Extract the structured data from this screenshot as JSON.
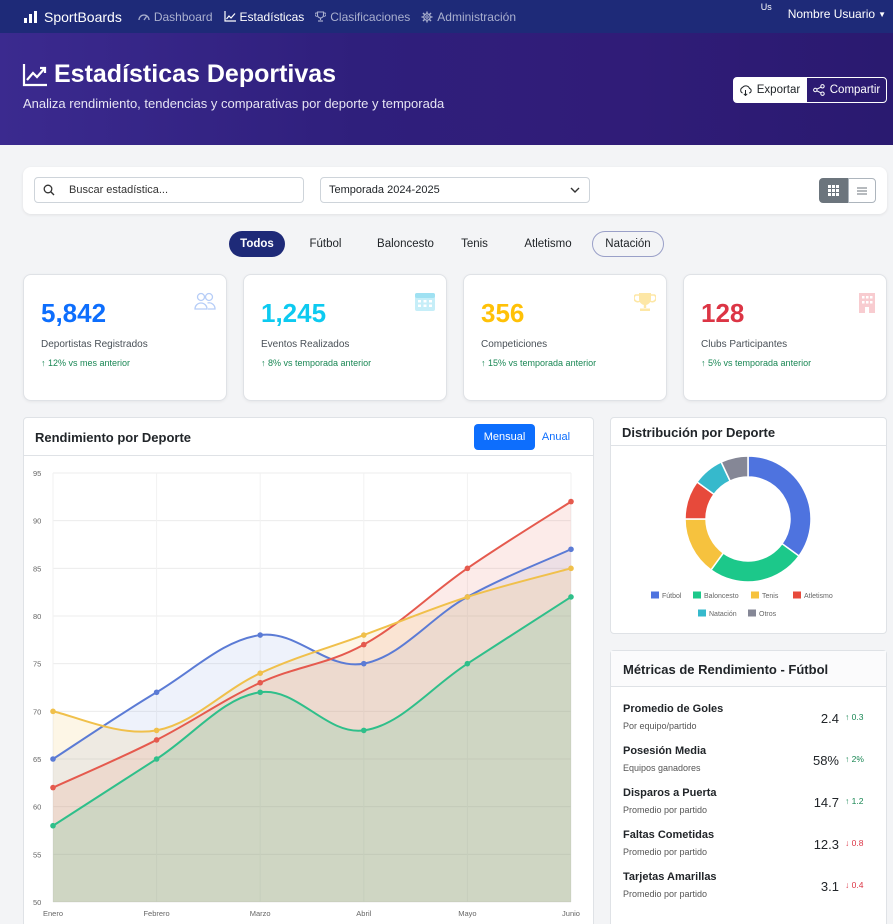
{
  "nav": {
    "brand": "SportBoards",
    "items": [
      {
        "label": "Dashboard",
        "icon": "speedometer-icon"
      },
      {
        "label": "Estadísticas",
        "icon": "chart-line-icon",
        "active": true
      },
      {
        "label": "Clasificaciones",
        "icon": "trophy-icon"
      },
      {
        "label": "Administración",
        "icon": "gear-icon"
      }
    ],
    "avatar_alt": "Us",
    "user_name": "Nombre Usuario"
  },
  "hero": {
    "title": "Estadísticas Deportivas",
    "subtitle": "Analiza rendimiento, tendencias y comparativas por deporte y temporada",
    "export_label": "Exportar",
    "share_label": "Compartir"
  },
  "filters": {
    "search_placeholder": "Buscar estadística...",
    "season_value": "Temporada 2024-2025"
  },
  "sport_tabs": [
    "Todos",
    "Fútbol",
    "Baloncesto",
    "Tenis",
    "Atletismo",
    "Natación"
  ],
  "stats": [
    {
      "value": "5,842",
      "label": "Deportistas Registrados",
      "change": "12% vs mes anterior",
      "color": "#0d6efd",
      "icon": "people-icon"
    },
    {
      "value": "1,245",
      "label": "Eventos Realizados",
      "change": "8% vs temporada anterior",
      "color": "#0dcaf0",
      "icon": "calendar-icon"
    },
    {
      "value": "356",
      "label": "Competiciones",
      "change": "15% vs temporada anterior",
      "color": "#ffc107",
      "icon": "trophy-icon"
    },
    {
      "value": "128",
      "label": "Clubs Participantes",
      "change": "5% vs temporada anterior",
      "color": "#dc3545",
      "icon": "building-icon"
    }
  ],
  "performance": {
    "title": "Rendimiento por Deporte",
    "mensual_label": "Mensual",
    "anual_label": "Anual"
  },
  "distribution": {
    "title": "Distribución por Deporte"
  },
  "chart_data": [
    {
      "type": "area",
      "title": "Rendimiento por Deporte",
      "categories": [
        "Enero",
        "Febrero",
        "Marzo",
        "Abril",
        "Mayo",
        "Junio"
      ],
      "ylim": [
        50,
        95
      ],
      "yticks": [
        50,
        55,
        60,
        65,
        70,
        75,
        80,
        85,
        90,
        95
      ],
      "grid": true,
      "series": [
        {
          "values": [
            65,
            72,
            78,
            75,
            82,
            87
          ],
          "color": "#5b7bd5"
        },
        {
          "values": [
            62,
            67,
            73,
            77,
            85,
            92
          ],
          "color": "#e55a4e"
        },
        {
          "values": [
            70,
            68,
            74,
            78,
            82,
            85
          ],
          "color": "#f0c04b"
        },
        {
          "values": [
            58,
            65,
            72,
            68,
            75,
            82
          ],
          "color": "#2fbf8a"
        }
      ]
    },
    {
      "type": "pie",
      "title": "Distribución por Deporte",
      "categories": [
        "Fútbol",
        "Baloncesto",
        "Tenis",
        "Atletismo",
        "Natación",
        "Otros"
      ],
      "values": [
        35,
        25,
        15,
        10,
        8,
        7
      ],
      "colors": [
        "#4e73df",
        "#1cc88a",
        "#f6c23e",
        "#e74a3b",
        "#36b9cc",
        "#858796"
      ],
      "legend": "bottom"
    }
  ],
  "metrics": {
    "title": "Métricas de Rendimiento - Fútbol",
    "items": [
      {
        "name": "Promedio de Goles",
        "sub": "Por equipo/partido",
        "value": "2.4",
        "change": "0.3",
        "dir": "up"
      },
      {
        "name": "Posesión Media",
        "sub": "Equipos ganadores",
        "value": "58%",
        "change": "2%",
        "dir": "up"
      },
      {
        "name": "Disparos a Puerta",
        "sub": "Promedio por partido",
        "value": "14.7",
        "change": "1.2",
        "dir": "up"
      },
      {
        "name": "Faltas Cometidas",
        "sub": "Promedio por partido",
        "value": "12.3",
        "change": "0.8",
        "dir": "down"
      },
      {
        "name": "Tarjetas Amarillas",
        "sub": "Promedio por partido",
        "value": "3.1",
        "change": "0.4",
        "dir": "down"
      }
    ]
  }
}
